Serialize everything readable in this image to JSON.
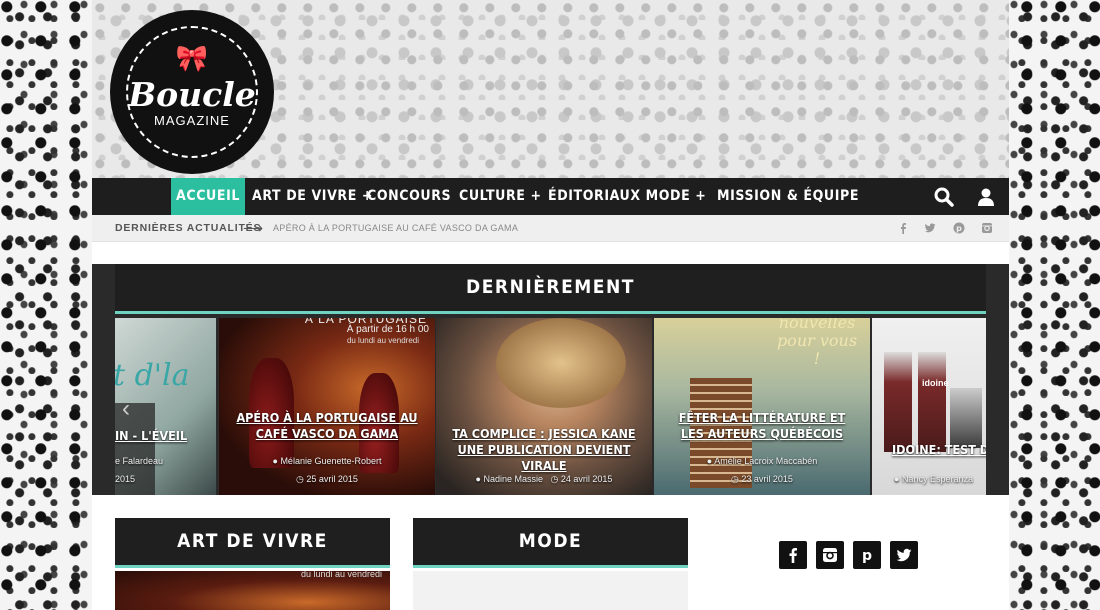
{
  "logo": {
    "bow": "🎀",
    "title": "Boucle",
    "subtitle": "MAGAZINE"
  },
  "nav": {
    "items": [
      {
        "label": "ACCUEIL",
        "active": true
      },
      {
        "label": "ART DE VIVRE +"
      },
      {
        "label": "CONCOURS"
      },
      {
        "label": "CULTURE +"
      },
      {
        "label": "ÉDITORIAUX"
      },
      {
        "label": "MODE +"
      },
      {
        "label": "MISSION & ÉQUIPE"
      }
    ],
    "icons": [
      "search-icon",
      "user-icon"
    ]
  },
  "ticker": {
    "label": "DERNIÈRES ACTUALITÉS",
    "arrow": "⟶",
    "text": "APÉRO À LA PORTUGAISE AU CAFÉ VASCO DA GAMA",
    "social_icons": [
      "facebook-icon",
      "twitter-icon",
      "pinterest-icon",
      "instagram-icon"
    ]
  },
  "slider": {
    "title": "DERNIÈREMENT",
    "prev_arrow": "‹",
    "slides": [
      {
        "title": "IN - L'ÉVEIL",
        "author": "e Falardeau",
        "date": "2015",
        "overlay": "t d'la"
      },
      {
        "title": "APÉRO À LA PORTUGAISE AU CAFÉ VASCO DA GAMA",
        "author": "Mélanie Guenette-Robert",
        "date": "25 avril 2015",
        "overlay": "À partir de 16 h 00",
        "overlay2": "du lundi au vendredi",
        "overlay3": "À LA PORTUGAISE"
      },
      {
        "title": "TA COMPLICE : JESSICA KANE UNE PUBLICATION DEVIENT VIRALE",
        "author": "Nadine Massie",
        "date": "24 avril 2015"
      },
      {
        "title": "FÊTER LA LITTÉRATURE ET LES AUTEURS QUÉBÉCOIS",
        "author": "Amélie Lacroix Maccabén",
        "date": "23 avril 2015",
        "overlay": "nouvelles pour vous !"
      },
      {
        "title": "IDOINE: TEST DE TI",
        "author": "Nancy Esperanza",
        "overlay": "idoine"
      }
    ]
  },
  "boxes": [
    {
      "title": "ART DE VIVRE",
      "overlay": "du lundi au vendredi"
    },
    {
      "title": "MODE"
    }
  ],
  "social_buttons": [
    "facebook-icon",
    "instagram-icon",
    "pinterest-icon",
    "twitter-icon"
  ],
  "colors": {
    "accent": "#2bbfa0",
    "nav_bg": "#1e1e1e",
    "rule": "#6fd3c2"
  }
}
